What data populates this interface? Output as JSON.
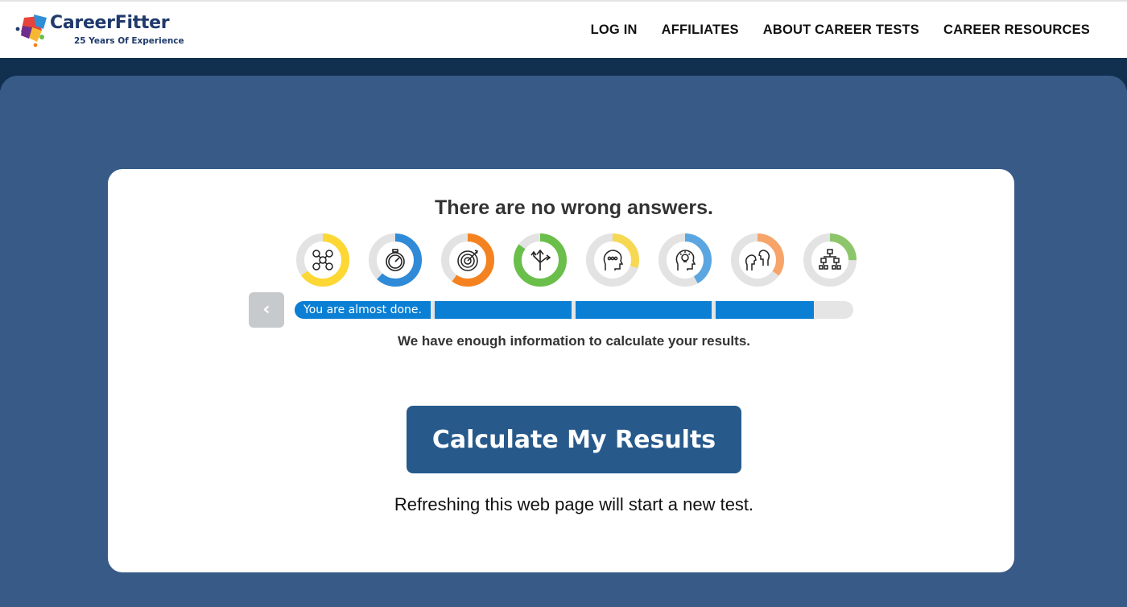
{
  "header": {
    "logo_title": "CareerFitter",
    "logo_sub": "25 Years Of Experience",
    "nav": [
      "LOG IN",
      "AFFILIATES",
      "ABOUT CAREER TESTS",
      "CAREER RESOURCES"
    ]
  },
  "card": {
    "headline": "There are no wrong answers.",
    "icons": [
      {
        "name": "money-network-icon",
        "color": "#fdd835",
        "fill": 0.65
      },
      {
        "name": "stopwatch-icon",
        "color": "#2f8ad8",
        "fill": 0.62
      },
      {
        "name": "target-icon",
        "color": "#f58220",
        "fill": 0.6
      },
      {
        "name": "direction-arrows-icon",
        "color": "#6abf4b",
        "fill": 0.85
      },
      {
        "name": "head-speech-icon",
        "color": "#f7d853",
        "fill": 0.3
      },
      {
        "name": "head-lightbulb-icon",
        "color": "#5ba6e0",
        "fill": 0.42
      },
      {
        "name": "two-faces-icon",
        "color": "#f6a46a",
        "fill": 0.35
      },
      {
        "name": "org-chart-icon",
        "color": "#8dc66a",
        "fill": 0.25
      }
    ],
    "back_label": "‹",
    "progress": {
      "label": "You are almost done.",
      "fill": 0.93,
      "segment_color": "#0a7fd4"
    },
    "info_text": "We have enough information to calculate your results.",
    "cta_label": "Calculate My Results",
    "note": "Refreshing this web page will start a new test."
  },
  "colors": {
    "page_bg": "#375a87",
    "band_dark": "#112f4e",
    "cta_bg": "#275a8b"
  }
}
